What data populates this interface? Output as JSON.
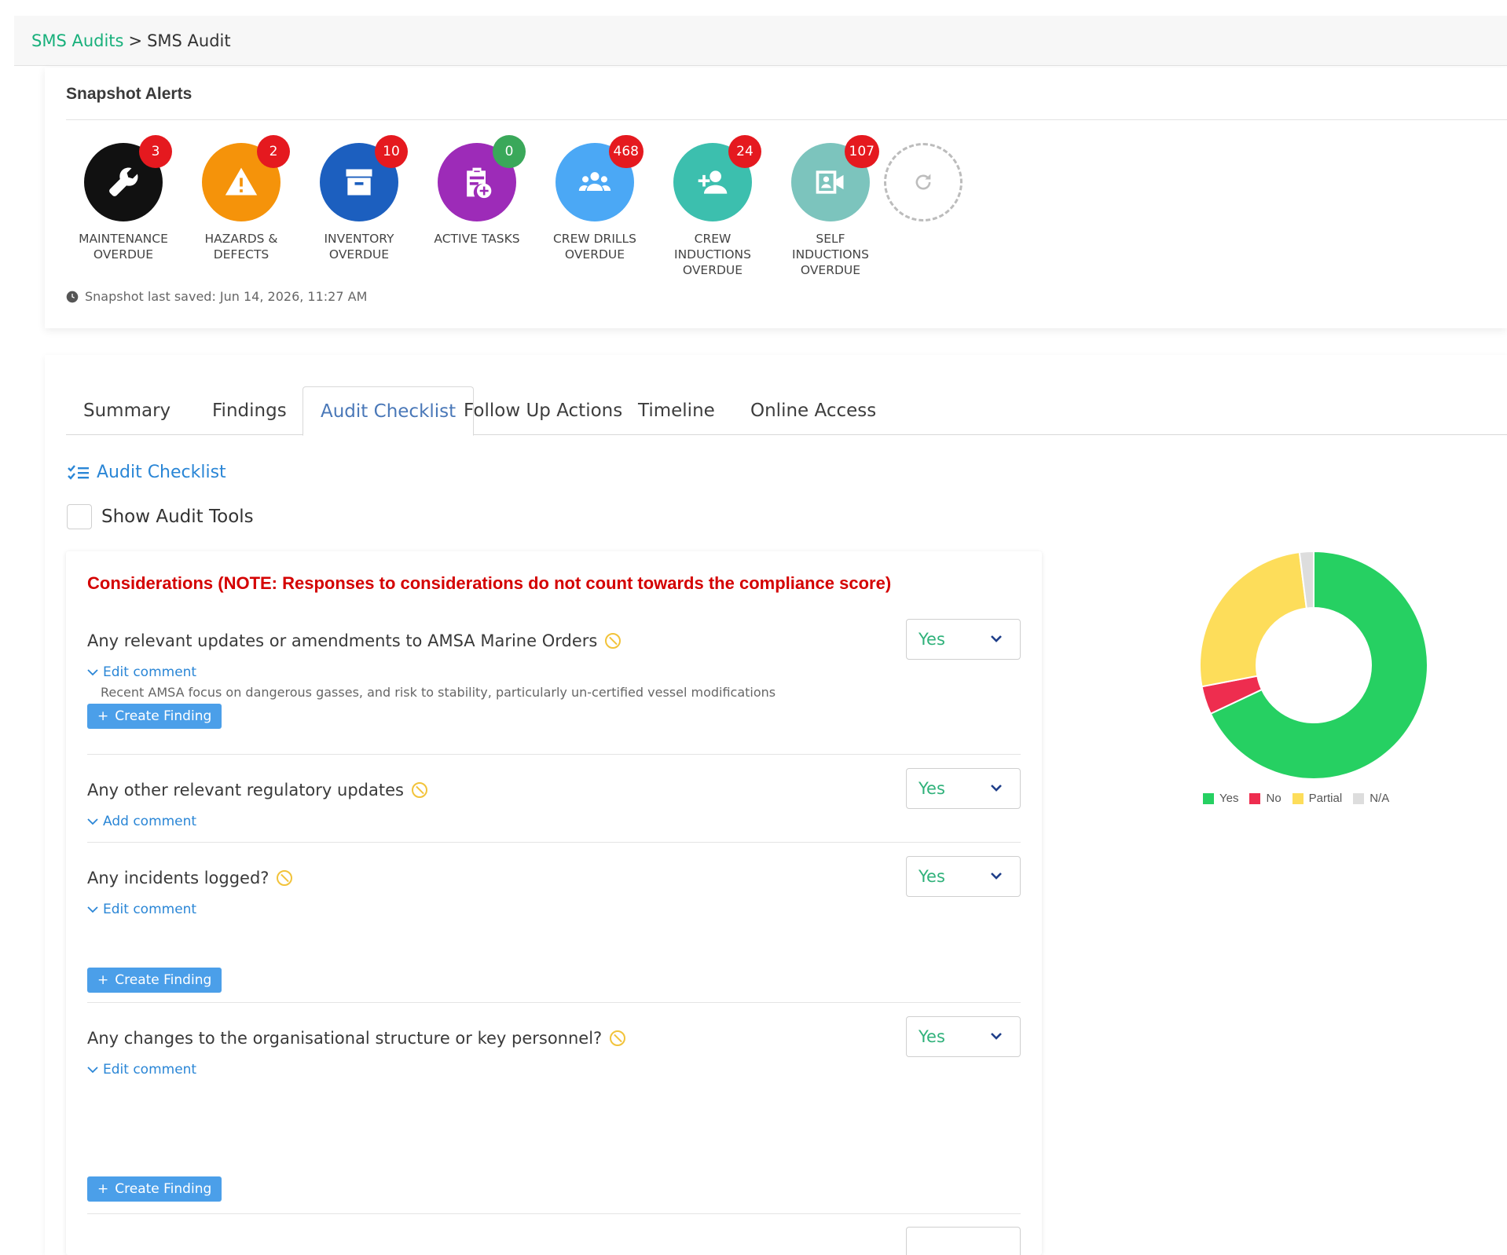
{
  "breadcrumb": {
    "parent": "SMS Audits",
    "separator": ">",
    "current": "SMS Audit"
  },
  "snapshot": {
    "title": "Snapshot Alerts",
    "alerts": [
      {
        "label1": "MAINTENANCE",
        "label2": "OVERDUE",
        "label3": "",
        "count": "3",
        "icon": "wrench-icon",
        "color": "#111111",
        "badge_color": "#e5191f"
      },
      {
        "label1": "HAZARDS &",
        "label2": "DEFECTS",
        "label3": "",
        "count": "2",
        "icon": "warning-icon",
        "color": "#f5930a",
        "badge_color": "#e5191f"
      },
      {
        "label1": "INVENTORY",
        "label2": "OVERDUE",
        "label3": "",
        "count": "10",
        "icon": "archive-icon",
        "color": "#1c5fbf",
        "badge_color": "#e5191f"
      },
      {
        "label1": "ACTIVE TASKS",
        "label2": "",
        "label3": "",
        "count": "0",
        "icon": "clipboard-plus-icon",
        "color": "#9d2bb8",
        "badge_color": "#3aa85a"
      },
      {
        "label1": "CREW DRILLS",
        "label2": "OVERDUE",
        "label3": "",
        "count": "468",
        "icon": "group-icon",
        "color": "#4ba8f5",
        "badge_color": "#e5191f"
      },
      {
        "label1": "CREW",
        "label2": "INDUCTIONS",
        "label3": "OVERDUE",
        "count": "24",
        "icon": "user-plus-icon",
        "color": "#3cbfae",
        "badge_color": "#e5191f"
      },
      {
        "label1": "SELF",
        "label2": "INDUCTIONS",
        "label3": "OVERDUE",
        "count": "107",
        "icon": "video-badge-icon",
        "color": "#7cc4bd",
        "badge_color": "#e5191f"
      }
    ],
    "saved": "Snapshot last saved: Jun 14, 2026, 11:27 AM"
  },
  "tabs": [
    "Summary",
    "Findings",
    "Audit Checklist",
    "Follow Up Actions",
    "Timeline",
    "Online Access"
  ],
  "active_tab": "Audit Checklist",
  "checklist": {
    "title": "Audit Checklist",
    "show_tools_label": "Show Audit Tools",
    "considerations_title": "Considerations (NOTE: Responses to considerations do not count towards the compliance score)",
    "items": [
      {
        "question": "Any relevant updates or amendments to AMSA Marine Orders",
        "answer": "Yes",
        "comment_link": "Edit comment",
        "comment": "Recent AMSA focus on dangerous gasses, and risk to stability, particularly un-certified vessel modifications",
        "finding_label": "Create Finding"
      },
      {
        "question": "Any other relevant regulatory updates",
        "answer": "Yes",
        "comment_link": "Add comment",
        "comment": "",
        "finding_label": ""
      },
      {
        "question": "Any incidents logged?",
        "answer": "Yes",
        "comment_link": "Edit comment",
        "comment": "",
        "finding_label": "Create Finding"
      },
      {
        "question": "Any changes to the organisational structure or key personnel?",
        "answer": "Yes",
        "comment_link": "Edit comment",
        "comment": "",
        "finding_label": "Create Finding"
      }
    ]
  },
  "chart_data": {
    "type": "pie",
    "categories": [
      "Yes",
      "No",
      "Partial",
      "N/A"
    ],
    "values": [
      68,
      4,
      26,
      2
    ],
    "colors": [
      "#26d062",
      "#ee2d4f",
      "#fddd5a",
      "#dddddd"
    ],
    "legend": "bottom",
    "donut": true
  }
}
